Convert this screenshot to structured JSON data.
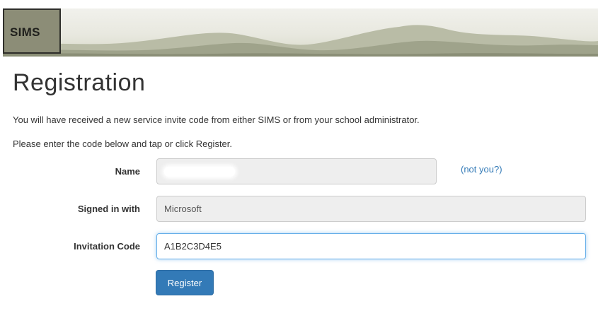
{
  "header": {
    "logo_text": "SIMS"
  },
  "page": {
    "title": "Registration",
    "intro_line_1": "You will have received a new service invite code from either SIMS or from your school administrator.",
    "intro_line_2": "Please enter the code below and tap or click Register."
  },
  "form": {
    "name_label": "Name",
    "name_value": "",
    "not_you_link": "(not you?)",
    "signed_in_label": "Signed in with",
    "signed_in_value": "Microsoft",
    "invitation_label": "Invitation Code",
    "invitation_value": "A1B2C3D4E5",
    "register_button": "Register"
  },
  "colors": {
    "primary": "#337ab7",
    "link": "#337ab7",
    "logo_bg": "#8c8d77",
    "readonly_field_bg": "#eeeeee",
    "focus_border": "#66afe9"
  },
  "icons": {
    "banner": "mountain-landscape-banner"
  }
}
